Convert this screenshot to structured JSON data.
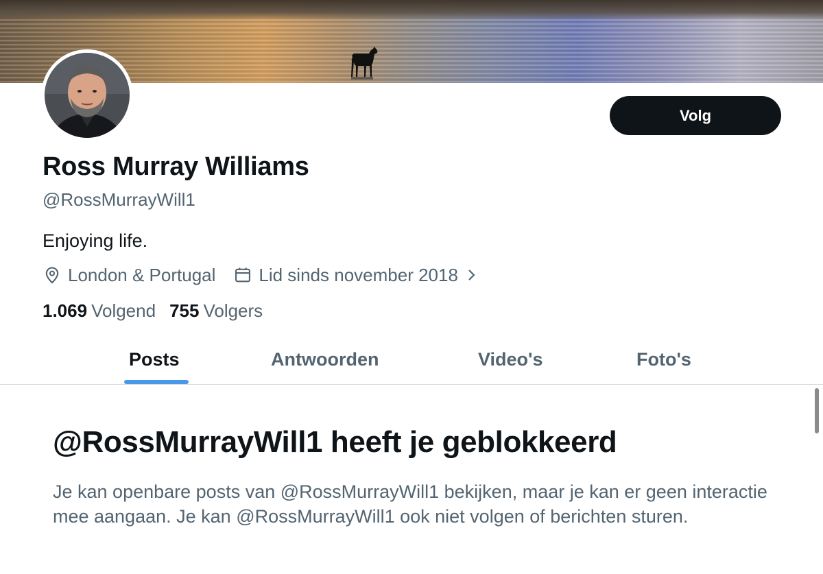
{
  "profile": {
    "display_name": "Ross Murray Williams",
    "handle": "@RossMurrayWill1",
    "bio": "Enjoying life.",
    "location": "London & Portugal",
    "joined": "Lid sinds november 2018",
    "following_count": "1.069",
    "following_label": "Volgend",
    "followers_count": "755",
    "followers_label": "Volgers",
    "follow_button_label": "Volg"
  },
  "tabs": [
    {
      "label": "Posts",
      "active": true
    },
    {
      "label": "Antwoorden",
      "active": false
    },
    {
      "label": "Video's",
      "active": false
    },
    {
      "label": "Foto's",
      "active": false
    }
  ],
  "blocked_notice": {
    "title": "@RossMurrayWill1 heeft je geblokkeerd",
    "body": "Je kan openbare posts van @RossMurrayWill1 bekijken, maar je kan er geen interactie mee aangaan. Je kan @RossMurrayWill1 ook niet volgen of berichten sturen."
  },
  "icons": {
    "location": "map-pin-icon",
    "joined": "calendar-icon",
    "more": "chevron-right-icon"
  },
  "colors": {
    "primary_text": "#0f1419",
    "secondary_text": "#536471",
    "accent": "#4a99e9",
    "follow_button_bg": "#0f1419"
  }
}
